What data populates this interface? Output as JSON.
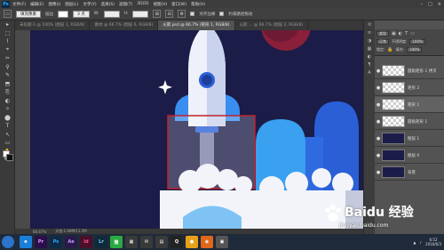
{
  "app": {
    "logo": "Ps"
  },
  "menubar": {
    "items": [
      "文件(F)",
      "编辑(E)",
      "图像(I)",
      "图层(L)",
      "文字(Y)",
      "选择(S)",
      "滤镜(T)",
      "3D(D)",
      "视图(V)",
      "窗口(W)",
      "帮助(H)"
    ],
    "controls": [
      "–",
      "□",
      "×"
    ]
  },
  "options_bar": {
    "shape_mode": "填充像素",
    "stroke_label": "描边",
    "stroke_value": "3 点",
    "w_label": "W:",
    "h_label": "H:",
    "align_label": "对齐边缘",
    "constrain_label": "约束路径拖动"
  },
  "tabs": [
    {
      "label": "未标题-1 @ 100% (图层 1, RGB/8)",
      "active": false
    },
    {
      "label": "素材 @ 66.7% (图层 6, RGB/8)",
      "active": false
    },
    {
      "label": "火箭.psd @ 66.7% (矩形 1, RGB/8)",
      "active": true
    },
    {
      "label": "火箭 ... @ 66.7% (图层 2, RGB/8)",
      "active": false
    }
  ],
  "status": {
    "zoom": "66.67%",
    "doc": "文档:1.98M/11.5M"
  },
  "tools": [
    "▸",
    "⬚",
    "⌇",
    "⌖",
    "✂",
    "⚲",
    "✎",
    "⬒",
    "⎘",
    "◐",
    "✧",
    "⬤",
    "T",
    "↖",
    "▭",
    "✋",
    "🔍"
  ],
  "layers_panel": {
    "kind_label": "类型",
    "mode": "正常",
    "opacity_label": "不透明度:",
    "opacity": "100%",
    "lock_label": "锁定:",
    "fill_label": "填充:",
    "fill": "100%",
    "layers": [
      {
        "name": "圆角矩形 1 拷贝",
        "visible": true,
        "thumb": "checker",
        "selected": false
      },
      {
        "name": "矩形 2",
        "visible": true,
        "thumb": "checker",
        "selected": false
      },
      {
        "name": "矩形 1",
        "visible": true,
        "thumb": "checker",
        "selected": true
      },
      {
        "name": "圆角矩形 1",
        "visible": true,
        "thumb": "checker",
        "selected": false
      },
      {
        "name": "图层 1",
        "visible": true,
        "thumb": "navy",
        "selected": false
      },
      {
        "name": "图层 0",
        "visible": true,
        "thumb": "navy",
        "selected": false
      },
      {
        "name": "背景",
        "visible": true,
        "thumb": "navy",
        "selected": false
      }
    ]
  },
  "taskbar": {
    "apps": [
      {
        "label": "e",
        "color": "#1a7fd8"
      },
      {
        "label": "Pr",
        "color": "#2a0f4a"
      },
      {
        "label": "Ps",
        "color": "#0f2a45"
      },
      {
        "label": "Ae",
        "color": "#2a1a4a"
      },
      {
        "label": "Id",
        "color": "#4a0f2a"
      },
      {
        "label": "Lr",
        "color": "#0f2a3a"
      },
      {
        "label": "微",
        "color": "#2aa842"
      },
      {
        "label": "▦",
        "color": "#3a3a3a"
      },
      {
        "label": "✉",
        "color": "#3a3a3a"
      },
      {
        "label": "▤",
        "color": "#3a3a3a"
      },
      {
        "label": "Q",
        "color": "#222"
      },
      {
        "label": "●",
        "color": "#e8a21a"
      },
      {
        "label": "◉",
        "color": "#e0671a"
      },
      {
        "label": "▣",
        "color": "#555"
      }
    ],
    "time": "6:52",
    "date": "2016/6/3"
  },
  "watermark": {
    "text": "Baidu 经验",
    "url": "jingyan.baidu.com"
  },
  "colors": {
    "canvas_bg": "#1b1c47",
    "selection_red": "#c0232b",
    "accent_blue": "#3aa0f0"
  }
}
